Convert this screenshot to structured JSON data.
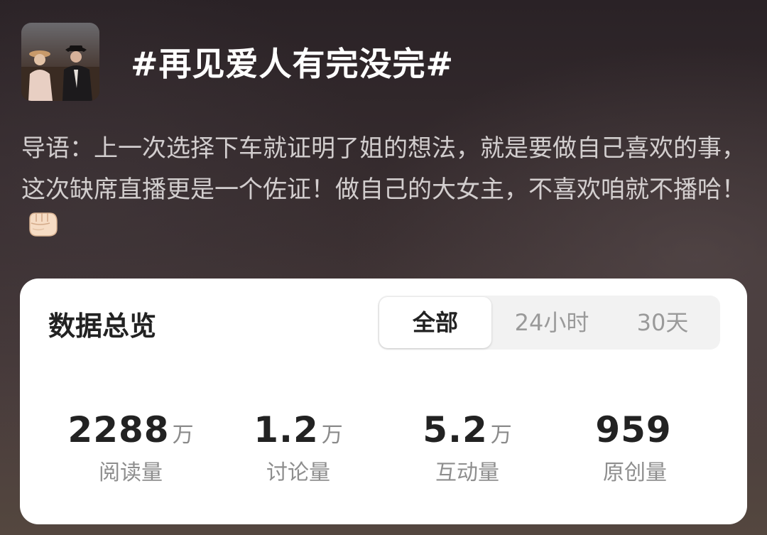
{
  "topic": {
    "title": "#再见爱人有完没完#"
  },
  "intro": {
    "text": "导语：上一次选择下车就证明了姐的想法，就是要做自己喜欢的事，这次缺席直播更是一个佐证！做自己的大女主，不喜欢咱就不播哈！",
    "emoji": "fist-icon"
  },
  "stats_card": {
    "title": "数据总览",
    "tabs": [
      {
        "label": "全部",
        "selected": true
      },
      {
        "label": "24小时",
        "selected": false
      },
      {
        "label": "30天",
        "selected": false
      }
    ],
    "stats": [
      {
        "value": "2288",
        "unit": "万",
        "label": "阅读量"
      },
      {
        "value": "1.2",
        "unit": "万",
        "label": "讨论量"
      },
      {
        "value": "5.2",
        "unit": "万",
        "label": "互动量"
      },
      {
        "value": "959",
        "unit": "",
        "label": "原创量"
      }
    ]
  },
  "colors": {
    "card_background": "#ffffff",
    "title_text": "#ffffff",
    "intro_text": "#ebe8e8",
    "primary_text": "#222222",
    "secondary_text": "#8e8e8e",
    "segment_background": "#f2f2f2"
  }
}
